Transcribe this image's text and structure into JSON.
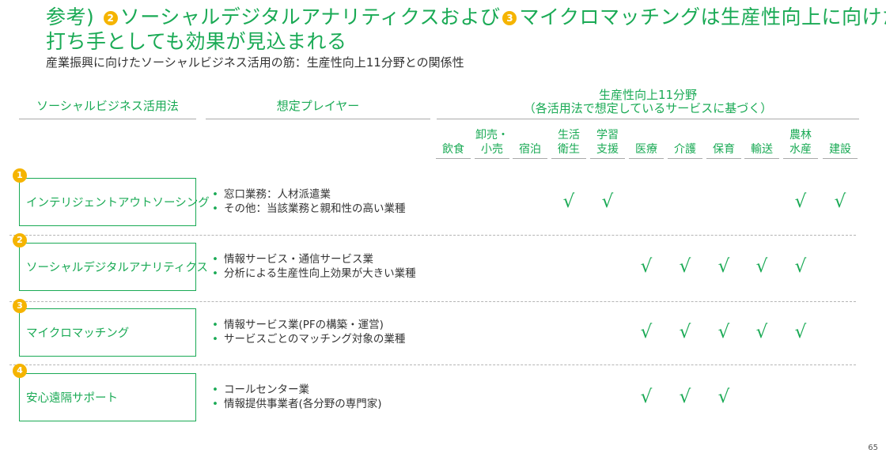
{
  "title": {
    "prefix": "参考)",
    "badge_a": "2",
    "part_a": "ソーシャルデジタルアナリティクスおよび",
    "badge_b": "3",
    "part_b": "マイクロマッチングは生産性向上に向けた",
    "line2": "打ち手としても効果が見込まれる"
  },
  "subtitle": "産業振興に向けたソーシャルビジネス活用の筋：生産性向上11分野との関係性",
  "headers": {
    "method": "ソーシャルビジネス活用法",
    "players": "想定プレイヤー",
    "sectors_title": "生産性向上11分野",
    "sectors_note": "（各活用法で想定しているサービスに基づく）"
  },
  "sectors": [
    [
      "",
      "飲食"
    ],
    [
      "卸売・",
      "小売"
    ],
    [
      "",
      "宿泊"
    ],
    [
      "生活",
      "衛生"
    ],
    [
      "学習",
      "支援"
    ],
    [
      "",
      "医療"
    ],
    [
      "",
      "介護"
    ],
    [
      "",
      "保育"
    ],
    [
      "",
      "輸送"
    ],
    [
      "農林",
      "水産"
    ],
    [
      "",
      "建設"
    ]
  ],
  "check_mark": "√",
  "rows": [
    {
      "num": "1",
      "method": "インテリジェントアウトソーシング",
      "players": [
        "窓口業務：人材派遣業",
        "その他：当該業務と親和性の高い業種"
      ],
      "checks": [
        3,
        4,
        9,
        10
      ]
    },
    {
      "num": "2",
      "method": "ソーシャルデジタルアナリティクス",
      "players": [
        "情報サービス・通信サービス業",
        "分析による生産性向上効果が大きい業種"
      ],
      "checks": [
        5,
        6,
        7,
        8,
        9
      ]
    },
    {
      "num": "3",
      "method": "マイクロマッチング",
      "players": [
        "情報サービス業(PFの構築・運営)",
        "サービスごとのマッチング対象の業種"
      ],
      "checks": [
        5,
        6,
        7,
        8,
        9
      ]
    },
    {
      "num": "4",
      "method": "安心遠隔サポート",
      "players": [
        "コールセンター業",
        "情報提供事業者(各分野の専門家)"
      ],
      "checks": [
        5,
        6,
        7
      ]
    }
  ],
  "page_number": "65",
  "colors": {
    "accent": "#1aaa55",
    "badge": "#f5b400"
  }
}
